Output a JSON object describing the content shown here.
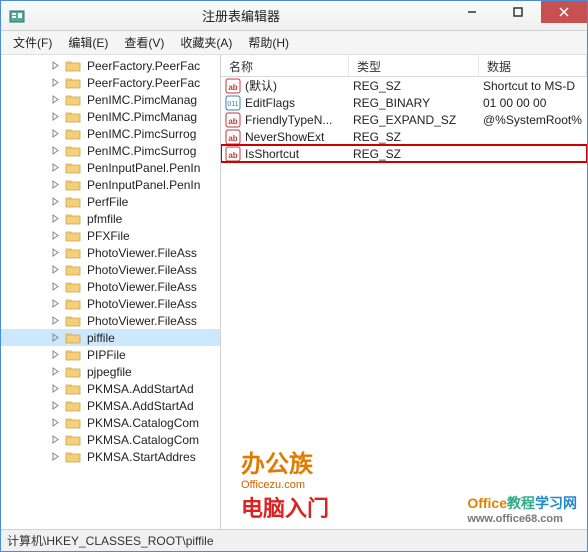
{
  "window": {
    "title": "注册表编辑器"
  },
  "menubar": {
    "file": "文件(F)",
    "edit": "编辑(E)",
    "view": "查看(V)",
    "favorites": "收藏夹(A)",
    "help": "帮助(H)"
  },
  "tree": {
    "items": [
      "PeerFactory.PeerFac",
      "PeerFactory.PeerFac",
      "PenIMC.PimcManag",
      "PenIMC.PimcManag",
      "PenIMC.PimcSurrog",
      "PenIMC.PimcSurrog",
      "PenInputPanel.PenIn",
      "PenInputPanel.PenIn",
      "PerfFile",
      "pfmfile",
      "PFXFile",
      "PhotoViewer.FileAss",
      "PhotoViewer.FileAss",
      "PhotoViewer.FileAss",
      "PhotoViewer.FileAss",
      "PhotoViewer.FileAss",
      "piffile",
      "PIPFile",
      "pjpegfile",
      "PKMSA.AddStartAd",
      "PKMSA.AddStartAd",
      "PKMSA.CatalogCom",
      "PKMSA.CatalogCom",
      "PKMSA.StartAddres"
    ],
    "selected_index": 16
  },
  "list": {
    "headers": {
      "name": "名称",
      "type": "类型",
      "data": "数据"
    },
    "rows": [
      {
        "icon": "string",
        "name": "(默认)",
        "type": "REG_SZ",
        "data": "Shortcut to MS-D"
      },
      {
        "icon": "binary",
        "name": "EditFlags",
        "type": "REG_BINARY",
        "data": "01 00 00 00"
      },
      {
        "icon": "string",
        "name": "FriendlyTypeN...",
        "type": "REG_EXPAND_SZ",
        "data": "@%SystemRoot%"
      },
      {
        "icon": "string",
        "name": "NeverShowExt",
        "type": "REG_SZ",
        "data": ""
      },
      {
        "icon": "string",
        "name": "IsShortcut",
        "type": "REG_SZ",
        "data": ""
      }
    ],
    "highlighted_index": 4
  },
  "statusbar": {
    "path": "计算机\\HKEY_CLASSES_ROOT\\piffile"
  },
  "watermarks": {
    "wm1": "办公族",
    "wm1_sub": "Officezu.com",
    "wm2": "电脑入门",
    "wm3_a": "Office",
    "wm3_b": "教程",
    "wm3_c": "学习网",
    "wm3_sub": "www.office68.com"
  }
}
